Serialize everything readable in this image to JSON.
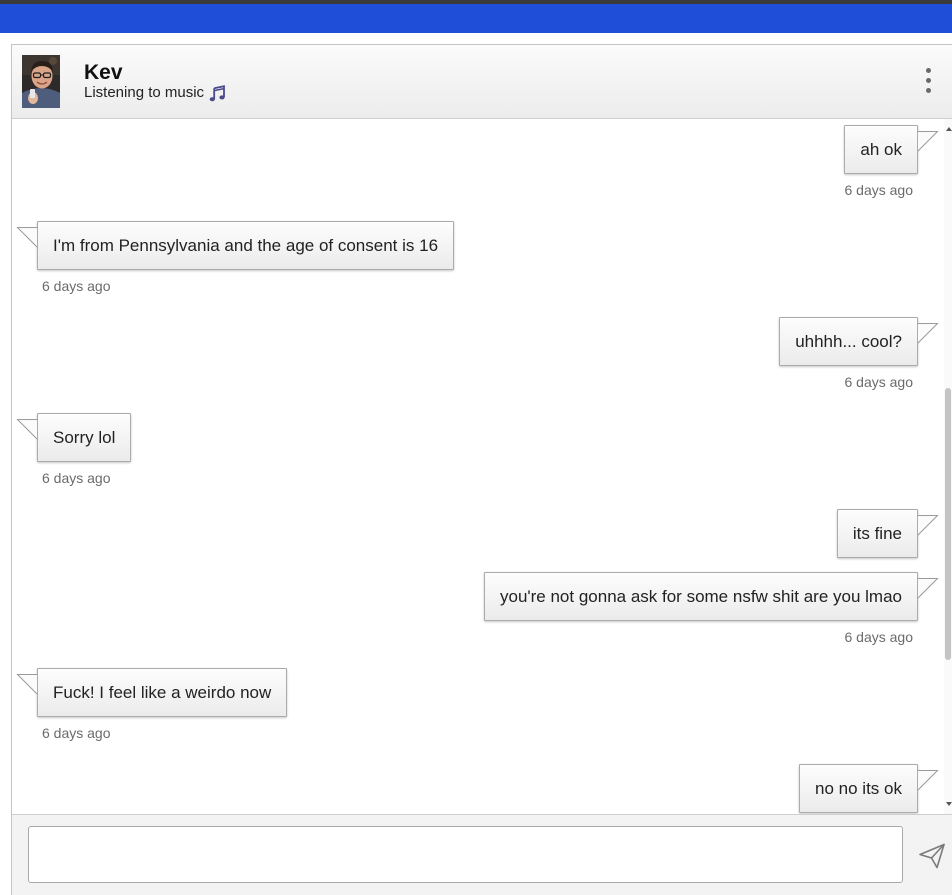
{
  "contact": {
    "name": "Kev",
    "status": "Listening to music"
  },
  "messages": [
    {
      "align": "right",
      "text": "ah ok",
      "time": "6 days ago"
    },
    {
      "align": "left",
      "text": "I'm from Pennsylvania and the age of consent is 16",
      "time": "6 days ago"
    },
    {
      "align": "right",
      "text": "uhhhh... cool?",
      "time": "6 days ago"
    },
    {
      "align": "left",
      "text": "Sorry lol",
      "time": "6 days ago"
    },
    {
      "align": "right",
      "text": "its fine"
    },
    {
      "align": "right",
      "text": "you're not gonna ask for some nsfw shit are you lmao",
      "time": "6 days ago"
    },
    {
      "align": "left",
      "text": "Fuck! I feel like a weirdo now",
      "time": "6 days ago"
    },
    {
      "align": "right",
      "text": "no no its ok"
    }
  ],
  "composer": {
    "value": ""
  },
  "icons": {
    "avatar": "contact-avatar-photo",
    "status": "music-note-icon",
    "menu": "more-options-icon",
    "send": "send-icon"
  },
  "colors": {
    "top_strip": "#3a3a3a",
    "top_bar": "#1f4fd8",
    "timestamp": "#6b6b6b"
  }
}
